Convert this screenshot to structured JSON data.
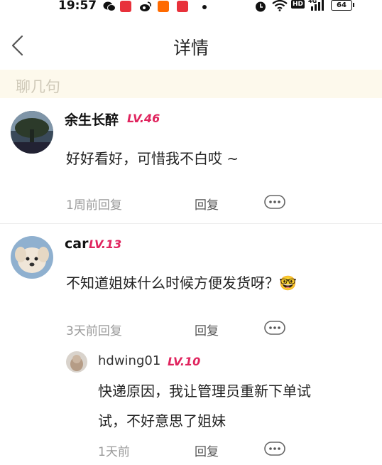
{
  "status_bar": {
    "time": "19:57",
    "hd_label": "HD",
    "network_label": "4G",
    "battery": "64"
  },
  "header": {
    "title": "详情"
  },
  "section": {
    "title": "聊几句"
  },
  "comments": [
    {
      "username": "余生长醉",
      "level": "LV.46",
      "content": "好好看好，可惜我不白哎 ~",
      "meta": "1周前回复",
      "reply_label": "回复"
    },
    {
      "username": "car",
      "level": "LV.13",
      "content": "不知道姐妹什么时候方便发货呀？🤓",
      "meta": "3天前回复",
      "reply_label": "回复",
      "replies": [
        {
          "username": "hdwing01",
          "level": "LV.10",
          "content_line1": "快递原因，我让管理员重新下单试",
          "content_line2": "试，不好意思了姐妹",
          "meta": "1天前",
          "reply_label": "回复"
        }
      ]
    }
  ],
  "colors": {
    "level": "#e0245e",
    "section_bg": "#fdf9ec",
    "meta": "#9a9a9a"
  }
}
